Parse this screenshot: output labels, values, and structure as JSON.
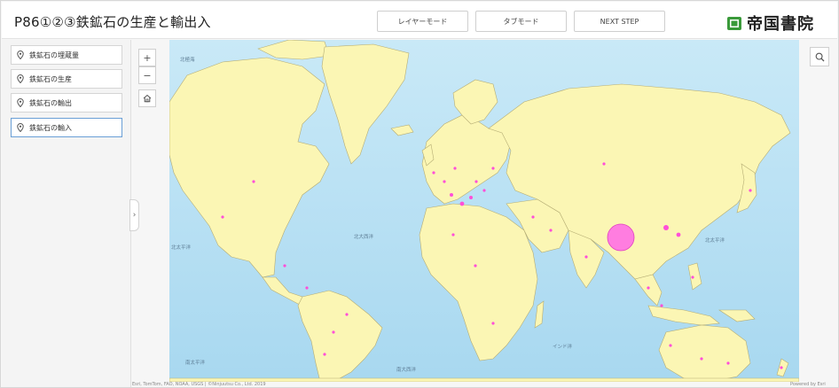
{
  "header": {
    "title": "P86①②③鉄鉱石の生産と輸出入",
    "buttons": {
      "layer_mode": "レイヤーモード",
      "tab_mode": "タブモード",
      "next_step": "NEXT STEP"
    },
    "brand": "帝国書院"
  },
  "sidebar": {
    "items": [
      {
        "label": "鉄鉱石の埋蔵量"
      },
      {
        "label": "鉄鉱石の生産"
      },
      {
        "label": "鉄鉱石の輸出"
      },
      {
        "label": "鉄鉱石の輸入"
      }
    ],
    "active_index": 3,
    "collapse_glyph": "›"
  },
  "map_controls": {
    "zoom_in": "+",
    "zoom_out": "−"
  },
  "map": {
    "ocean_labels": [
      "北極海",
      "北大西洋",
      "北太平洋",
      "北太平洋",
      "南大西洋",
      "南太平洋",
      "インド洋"
    ],
    "attribution": "Esri, TomTom, FAO, NOAA, USGS | ©Ninjuutsu Co., Ltd. 2019",
    "powered_by": "Powered by Esri",
    "colors": {
      "ocean": "#a8d8f0",
      "land": "#fbf6b4",
      "border": "#b5ad74",
      "marker": "#ff4fd8"
    }
  }
}
